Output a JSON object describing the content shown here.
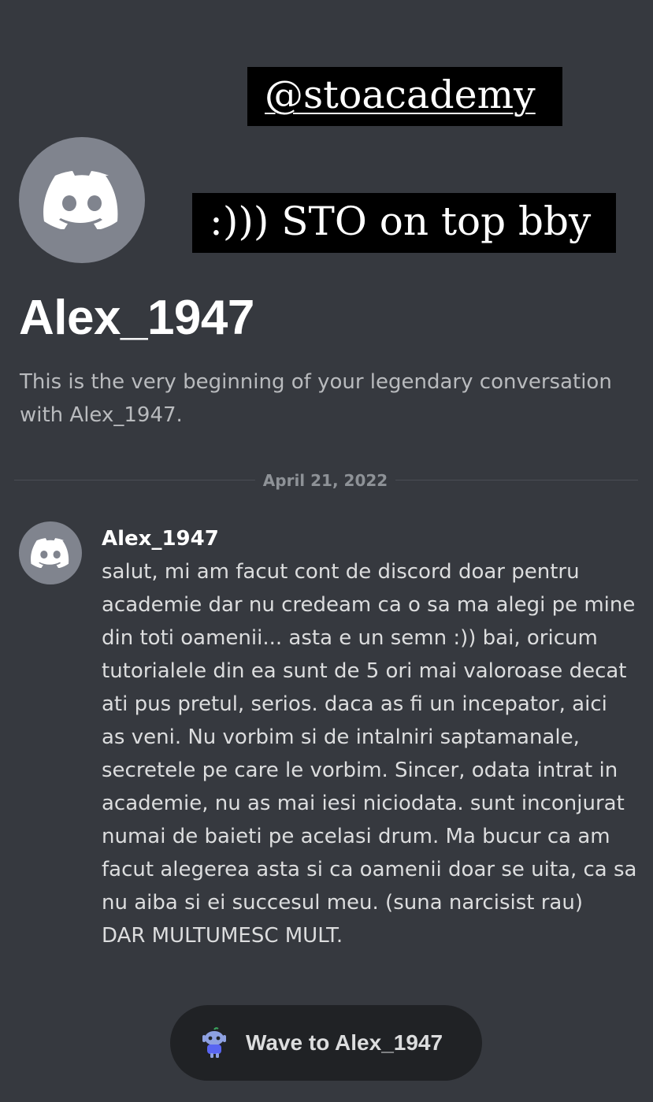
{
  "overlay": {
    "handle": "@stoacademy",
    "caption": ":))) STO on top bby"
  },
  "profile": {
    "name": "Alex_1947",
    "intro": "This is the very beginning of your legendary conversation with Alex_1947."
  },
  "divider": {
    "date": "April 21, 2022"
  },
  "message": {
    "author": "Alex_1947",
    "text": "salut, mi am facut cont de discord doar pentru\nacademie dar nu credeam ca o sa ma alegi pe mine\ndin toti oamenii... asta e un semn :)) bai, oricum\ntutorialele din ea sunt de 5 ori mai valoroase decat\nati pus pretul, serios. daca as fi un incepator, aici\nas veni. Nu vorbim si de intalniri saptamanale,\nsecretele pe care le vorbim. Sincer, odata intrat in\nacademie, nu as mai iesi niciodata. sunt inconjurat\nnumai de baieti pe acelasi drum. Ma bucur ca am\nfacut alegerea asta si ca oamenii doar se uita, ca sa\nnu aiba si ei succesul meu. (suna narcisist rau)\nDAR MULTUMESC MULT."
  },
  "wave": {
    "label": "Wave to Alex_1947",
    "icon": "wumpus-wave-icon"
  },
  "colors": {
    "background": "#36393f",
    "avatar": "#80848e",
    "button": "#202225",
    "accent": "#5865f2"
  }
}
